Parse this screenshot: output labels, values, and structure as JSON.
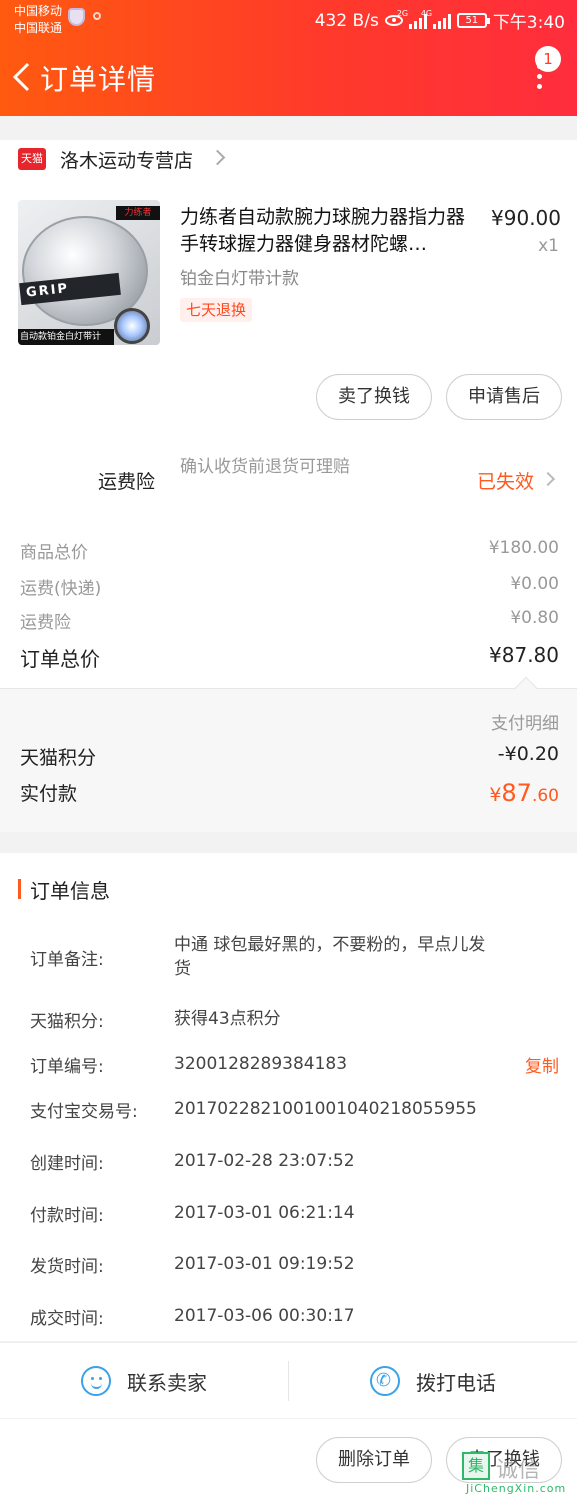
{
  "status_bar": {
    "carrier1": "中国移动",
    "carrier2": "中国联通",
    "speed": "432 B/s",
    "net1": "2G",
    "net2": "4G",
    "battery": "51",
    "time": "下午3:40"
  },
  "header": {
    "title": "订单详情",
    "message_count": "1",
    "gradient": [
      "#ff5a10",
      "#ff2d3d"
    ]
  },
  "shop": {
    "badge": "天猫",
    "name": "洛木运动专营店"
  },
  "product": {
    "image_brand": "力练者",
    "image_band_text": "GRIP",
    "image_caption": "自动款铂金白灯带计",
    "title": "力练者自动款腕力球腕力器指力器手转球握力器健身器材陀螺…",
    "sku": "铂金白灯带计款",
    "tag": "七天退换",
    "price": "¥90.00",
    "qty": "x1"
  },
  "item_actions": {
    "sell_label": "卖了换钱",
    "after_sale_label": "申请售后"
  },
  "insurance": {
    "label": "运费险",
    "desc": "确认收货前退货可理赔",
    "status": "已失效"
  },
  "fees": [
    {
      "label": "商品总价",
      "value": "¥180.00"
    },
    {
      "label": "运费(快递)",
      "value": "¥0.00"
    },
    {
      "label": "运费险",
      "value": "¥0.80"
    }
  ],
  "order_total": {
    "label": "订单总价",
    "value": "¥87.80"
  },
  "payment": {
    "detail_link": "支付明细",
    "points_label": "天猫积分",
    "points_value": "-¥0.20",
    "paid_label": "实付款",
    "paid_symbol": "¥",
    "paid_int": "87",
    "paid_dec": ".60"
  },
  "order_info": {
    "title": "订单信息",
    "rows": [
      {
        "key": "订单备注:",
        "value": "中通 球包最好黑的，不要粉的，早点儿发货"
      },
      {
        "key": "天猫积分:",
        "value": "获得43点积分"
      },
      {
        "key": "订单编号:",
        "value": "3200128289384183",
        "action": "复制"
      },
      {
        "key": "支付宝交易号:",
        "value": "2017022821001001040218055955"
      },
      {
        "key": "创建时间:",
        "value": "2017-02-28 23:07:52"
      },
      {
        "key": "付款时间:",
        "value": "2017-03-01 06:21:14"
      },
      {
        "key": "发货时间:",
        "value": "2017-03-01 09:19:52"
      },
      {
        "key": "成交时间:",
        "value": "2017-03-06 00:30:17"
      }
    ]
  },
  "contact": {
    "seller_label": "联系卖家",
    "phone_label": "拨打电话"
  },
  "bottom_actions": {
    "delete_label": "删除订单",
    "sell_label": "卖了换钱"
  },
  "watermark": {
    "logo_char": "集",
    "text": "诚信",
    "url": "JiChengXin.com"
  },
  "colors": {
    "accent": "#ff5a1f",
    "link_blue": "#3aa2e8"
  }
}
